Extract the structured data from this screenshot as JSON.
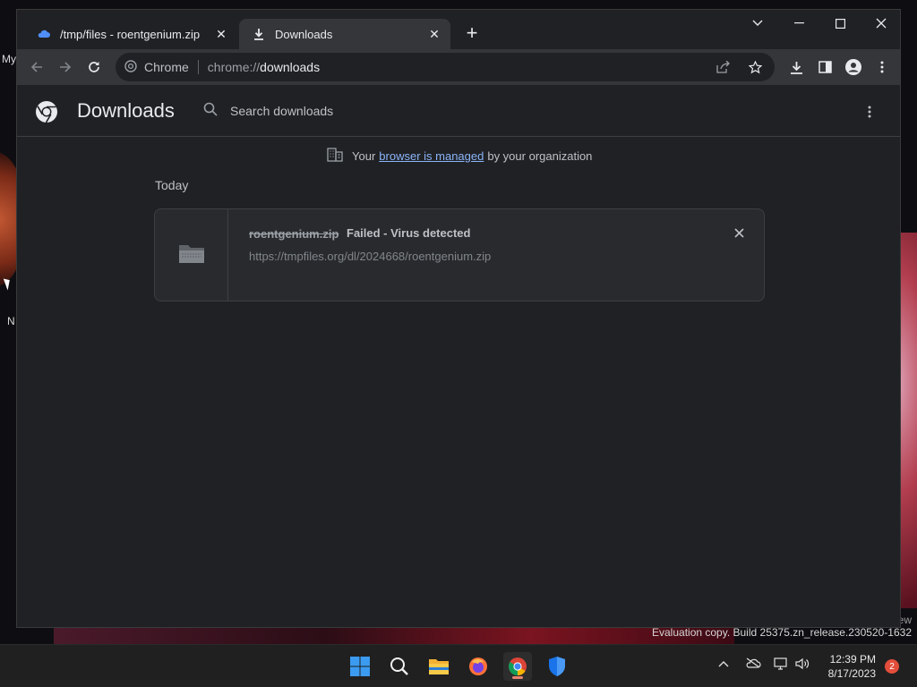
{
  "desktop": {
    "labels": [
      "My",
      "N"
    ],
    "watermark_line1": "ew",
    "watermark_line2": "Evaluation copy. Build 25375.zn_release.230520-1632"
  },
  "tabs": [
    {
      "title": "/tmp/files - roentgenium.zip",
      "icon": "cloud-icon",
      "active": false
    },
    {
      "title": "Downloads",
      "icon": "download-icon",
      "active": true
    }
  ],
  "new_tab_label": "+",
  "omnibox": {
    "chip": "Chrome",
    "url_scheme": "chrome://",
    "url_path": "downloads"
  },
  "downloads_page": {
    "title": "Downloads",
    "search_placeholder": "Search downloads",
    "managed_prefix": "Your",
    "managed_link": "browser is managed",
    "managed_suffix": "by your organization",
    "section_label": "Today",
    "items": [
      {
        "filename": "roentgenium.zip",
        "status": "Failed - Virus detected",
        "url": "https://tmpfiles.org/dl/2024668/roentgenium.zip"
      }
    ]
  },
  "taskbar": {
    "apps": [
      "start-icon",
      "search-icon",
      "file-explorer-icon",
      "firefox-icon",
      "chrome-icon",
      "defender-icon"
    ],
    "time": "12:39 PM",
    "date": "8/17/2023",
    "notification_count": "2"
  },
  "colors": {
    "accent_link": "#8ab4f8",
    "window_bg": "#202124",
    "toolbar_bg": "#35363a"
  }
}
